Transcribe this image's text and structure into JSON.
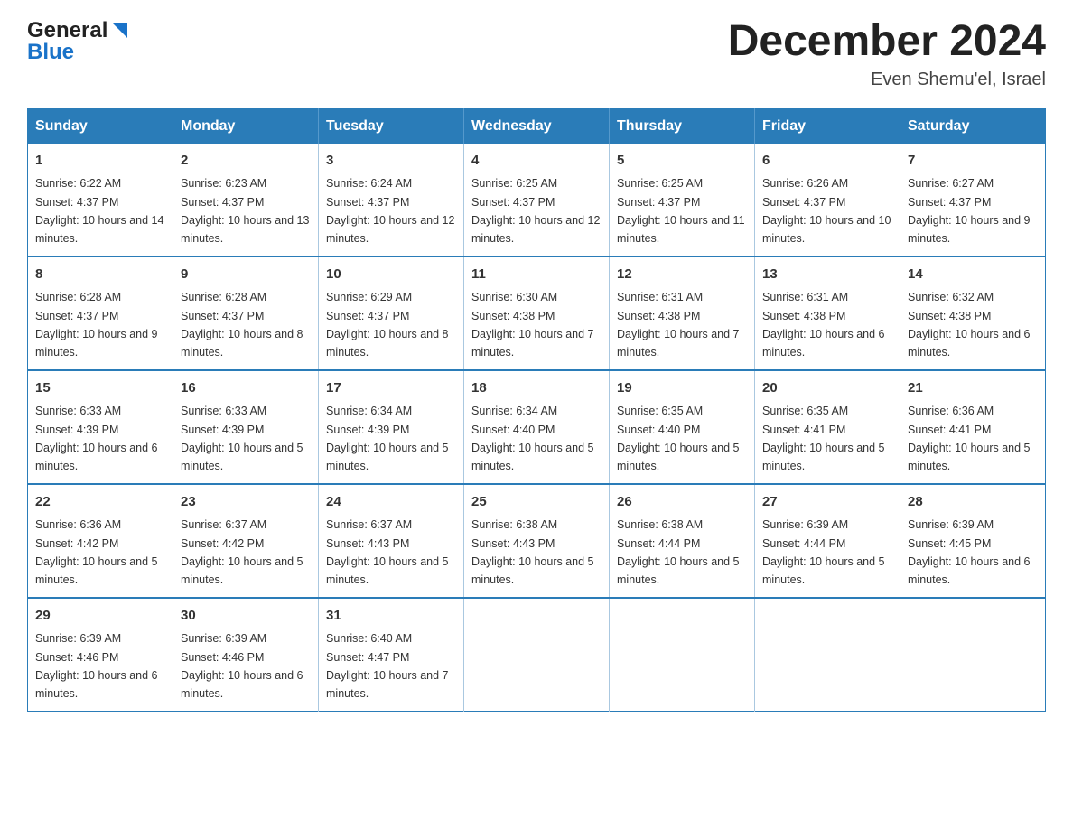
{
  "logo": {
    "general": "General",
    "blue": "Blue"
  },
  "header": {
    "title": "December 2024",
    "subtitle": "Even Shemu'el, Israel"
  },
  "days_of_week": [
    "Sunday",
    "Monday",
    "Tuesday",
    "Wednesday",
    "Thursday",
    "Friday",
    "Saturday"
  ],
  "weeks": [
    [
      {
        "day": "1",
        "sunrise": "6:22 AM",
        "sunset": "4:37 PM",
        "daylight": "10 hours and 14 minutes."
      },
      {
        "day": "2",
        "sunrise": "6:23 AM",
        "sunset": "4:37 PM",
        "daylight": "10 hours and 13 minutes."
      },
      {
        "day": "3",
        "sunrise": "6:24 AM",
        "sunset": "4:37 PM",
        "daylight": "10 hours and 12 minutes."
      },
      {
        "day": "4",
        "sunrise": "6:25 AM",
        "sunset": "4:37 PM",
        "daylight": "10 hours and 12 minutes."
      },
      {
        "day": "5",
        "sunrise": "6:25 AM",
        "sunset": "4:37 PM",
        "daylight": "10 hours and 11 minutes."
      },
      {
        "day": "6",
        "sunrise": "6:26 AM",
        "sunset": "4:37 PM",
        "daylight": "10 hours and 10 minutes."
      },
      {
        "day": "7",
        "sunrise": "6:27 AM",
        "sunset": "4:37 PM",
        "daylight": "10 hours and 9 minutes."
      }
    ],
    [
      {
        "day": "8",
        "sunrise": "6:28 AM",
        "sunset": "4:37 PM",
        "daylight": "10 hours and 9 minutes."
      },
      {
        "day": "9",
        "sunrise": "6:28 AM",
        "sunset": "4:37 PM",
        "daylight": "10 hours and 8 minutes."
      },
      {
        "day": "10",
        "sunrise": "6:29 AM",
        "sunset": "4:37 PM",
        "daylight": "10 hours and 8 minutes."
      },
      {
        "day": "11",
        "sunrise": "6:30 AM",
        "sunset": "4:38 PM",
        "daylight": "10 hours and 7 minutes."
      },
      {
        "day": "12",
        "sunrise": "6:31 AM",
        "sunset": "4:38 PM",
        "daylight": "10 hours and 7 minutes."
      },
      {
        "day": "13",
        "sunrise": "6:31 AM",
        "sunset": "4:38 PM",
        "daylight": "10 hours and 6 minutes."
      },
      {
        "day": "14",
        "sunrise": "6:32 AM",
        "sunset": "4:38 PM",
        "daylight": "10 hours and 6 minutes."
      }
    ],
    [
      {
        "day": "15",
        "sunrise": "6:33 AM",
        "sunset": "4:39 PM",
        "daylight": "10 hours and 6 minutes."
      },
      {
        "day": "16",
        "sunrise": "6:33 AM",
        "sunset": "4:39 PM",
        "daylight": "10 hours and 5 minutes."
      },
      {
        "day": "17",
        "sunrise": "6:34 AM",
        "sunset": "4:39 PM",
        "daylight": "10 hours and 5 minutes."
      },
      {
        "day": "18",
        "sunrise": "6:34 AM",
        "sunset": "4:40 PM",
        "daylight": "10 hours and 5 minutes."
      },
      {
        "day": "19",
        "sunrise": "6:35 AM",
        "sunset": "4:40 PM",
        "daylight": "10 hours and 5 minutes."
      },
      {
        "day": "20",
        "sunrise": "6:35 AM",
        "sunset": "4:41 PM",
        "daylight": "10 hours and 5 minutes."
      },
      {
        "day": "21",
        "sunrise": "6:36 AM",
        "sunset": "4:41 PM",
        "daylight": "10 hours and 5 minutes."
      }
    ],
    [
      {
        "day": "22",
        "sunrise": "6:36 AM",
        "sunset": "4:42 PM",
        "daylight": "10 hours and 5 minutes."
      },
      {
        "day": "23",
        "sunrise": "6:37 AM",
        "sunset": "4:42 PM",
        "daylight": "10 hours and 5 minutes."
      },
      {
        "day": "24",
        "sunrise": "6:37 AM",
        "sunset": "4:43 PM",
        "daylight": "10 hours and 5 minutes."
      },
      {
        "day": "25",
        "sunrise": "6:38 AM",
        "sunset": "4:43 PM",
        "daylight": "10 hours and 5 minutes."
      },
      {
        "day": "26",
        "sunrise": "6:38 AM",
        "sunset": "4:44 PM",
        "daylight": "10 hours and 5 minutes."
      },
      {
        "day": "27",
        "sunrise": "6:39 AM",
        "sunset": "4:44 PM",
        "daylight": "10 hours and 5 minutes."
      },
      {
        "day": "28",
        "sunrise": "6:39 AM",
        "sunset": "4:45 PM",
        "daylight": "10 hours and 6 minutes."
      }
    ],
    [
      {
        "day": "29",
        "sunrise": "6:39 AM",
        "sunset": "4:46 PM",
        "daylight": "10 hours and 6 minutes."
      },
      {
        "day": "30",
        "sunrise": "6:39 AM",
        "sunset": "4:46 PM",
        "daylight": "10 hours and 6 minutes."
      },
      {
        "day": "31",
        "sunrise": "6:40 AM",
        "sunset": "4:47 PM",
        "daylight": "10 hours and 7 minutes."
      },
      null,
      null,
      null,
      null
    ]
  ]
}
